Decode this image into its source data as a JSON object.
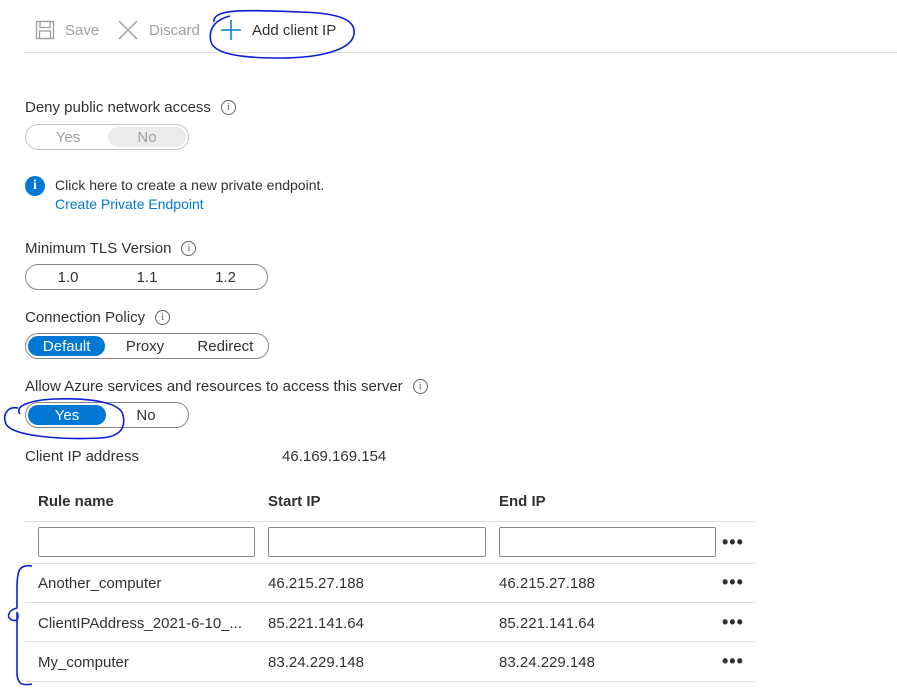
{
  "toolbar": {
    "save_label": "Save",
    "discard_label": "Discard",
    "add_client_ip_label": "Add client IP"
  },
  "deny_public": {
    "label": "Deny public network access",
    "options": [
      "Yes",
      "No"
    ],
    "selected": "No"
  },
  "private_endpoint": {
    "text": "Click here to create a new private endpoint.",
    "link": "Create Private Endpoint"
  },
  "tls": {
    "label": "Minimum TLS Version",
    "options": [
      "1.0",
      "1.1",
      "1.2"
    ]
  },
  "connection_policy": {
    "label": "Connection Policy",
    "options": [
      "Default",
      "Proxy",
      "Redirect"
    ],
    "selected": "Default"
  },
  "azure_services": {
    "label": "Allow Azure services and resources to access this server",
    "options": [
      "Yes",
      "No"
    ],
    "selected": "Yes"
  },
  "client_ip": {
    "label": "Client IP address",
    "value": "46.169.169.154"
  },
  "firewall_table": {
    "columns": [
      "Rule name",
      "Start IP",
      "End IP"
    ],
    "rows": [
      {
        "name": "Another_computer",
        "start": "46.215.27.188",
        "end": "46.215.27.188"
      },
      {
        "name": "ClientIPAddress_2021-6-10_...",
        "start": "85.221.141.64",
        "end": "85.221.141.64"
      },
      {
        "name": "My_computer",
        "start": "83.24.229.148",
        "end": "83.24.229.148"
      }
    ],
    "more_glyph": "•••"
  },
  "colors": {
    "accent": "#0078d4",
    "annotation": "#0a1fd6"
  }
}
